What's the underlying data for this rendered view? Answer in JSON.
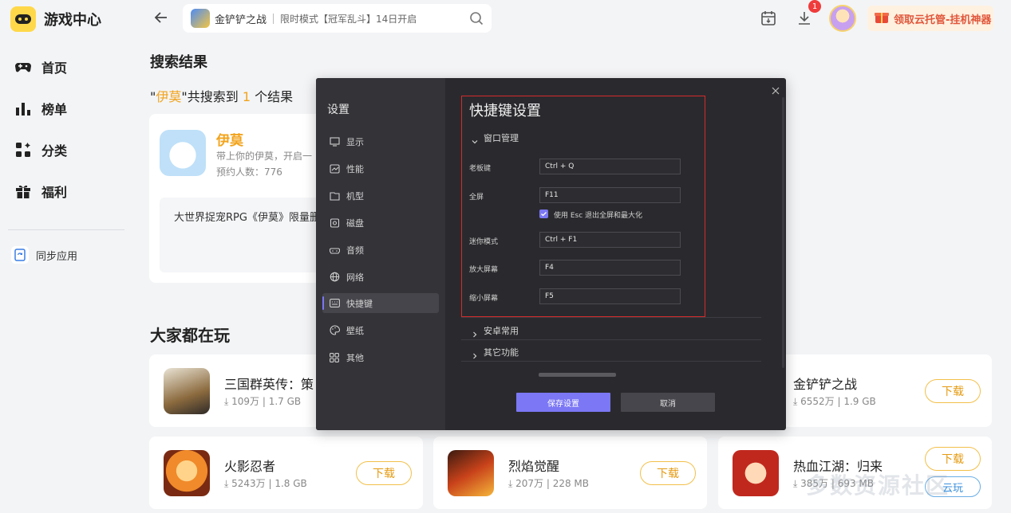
{
  "app": {
    "title": "游戏中心"
  },
  "sidebar": {
    "items": [
      {
        "label": "首页",
        "icon": "gamepad-icon"
      },
      {
        "label": "榜单",
        "icon": "chart-bars-icon"
      },
      {
        "label": "分类",
        "icon": "category-grid-icon"
      },
      {
        "label": "福利",
        "icon": "gift-icon"
      }
    ],
    "sync_label": "同步应用"
  },
  "topbar": {
    "search_game": "金铲铲之战",
    "search_promo": "限时模式【冠军乱斗】14日开启",
    "download_badge": "1",
    "cloud_button": "领取云托管-挂机神器"
  },
  "main": {
    "results_heading": "搜索结果",
    "results_prefix": "\"",
    "results_term": "伊莫",
    "results_mid": "\"共搜索到 ",
    "results_count": "1",
    "results_suffix": " 个结果",
    "result": {
      "name": "伊莫",
      "desc": "带上你的伊莫，开启一",
      "prereg": "预约人数：776",
      "intro": "大世界捉宠RPG《伊莫》限量删"
    },
    "popular_heading": "大家都在玩",
    "games": [
      {
        "name": "三国群英传：策",
        "downloads": "109万",
        "size": "1.7 GB"
      },
      {
        "name": "金铲铲之战",
        "downloads": "6552万",
        "size": "1.9 GB",
        "button": "下载"
      },
      {
        "name": "火影忍者",
        "downloads": "5243万",
        "size": "1.8 GB",
        "button": "下载"
      },
      {
        "name": "烈焰觉醒",
        "downloads": "207万",
        "size": "228 MB",
        "button": "下载"
      },
      {
        "name": "热血江湖：归来",
        "downloads": "385万",
        "size": "693 MB",
        "button": "下载",
        "button2": "云玩"
      }
    ]
  },
  "dialog": {
    "title": "设置",
    "menu": [
      {
        "label": "显示",
        "icon": "monitor-icon"
      },
      {
        "label": "性能",
        "icon": "performance-icon"
      },
      {
        "label": "机型",
        "icon": "device-icon"
      },
      {
        "label": "磁盘",
        "icon": "disk-icon"
      },
      {
        "label": "音频",
        "icon": "audio-icon"
      },
      {
        "label": "网络",
        "icon": "globe-icon"
      },
      {
        "label": "快捷键",
        "icon": "keyboard-icon"
      },
      {
        "label": "壁纸",
        "icon": "palette-icon"
      },
      {
        "label": "其他",
        "icon": "grid-icon"
      }
    ],
    "active_menu": "快捷键",
    "section_title": "快捷键设置",
    "group_window": "窗口管理",
    "rows": [
      {
        "label": "老板键",
        "value": "Ctrl + Q"
      },
      {
        "label": "全屏",
        "value": "F11"
      },
      {
        "label": "迷你模式",
        "value": "Ctrl + F1"
      },
      {
        "label": "放大屏幕",
        "value": "F4"
      },
      {
        "label": "缩小屏幕",
        "value": "F5"
      }
    ],
    "esc_checkbox": "使用 Esc 退出全屏和最大化",
    "group_android": "安卓常用",
    "group_other": "其它功能",
    "save_label": "保存设置",
    "cancel_label": "取消"
  },
  "watermark": "多数资源社区"
}
